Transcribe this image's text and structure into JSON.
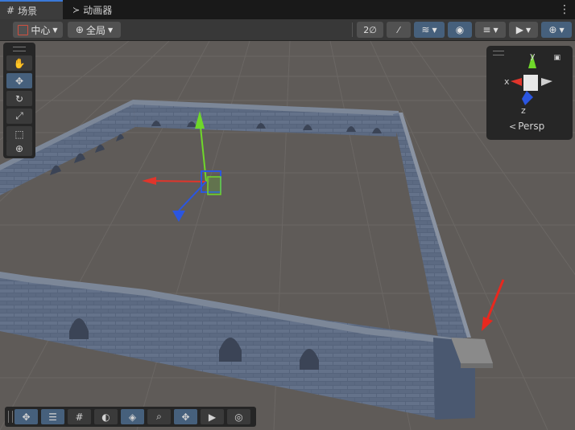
{
  "tabs": [
    {
      "label": "场景",
      "icon": "grid-icon",
      "active": true
    },
    {
      "label": "动画器",
      "icon": "animator-icon",
      "active": false
    }
  ],
  "toolbar": {
    "pivot_label": "中心",
    "space_label": "全局"
  },
  "scene_gizmo": {
    "projection_label": "Persp",
    "axis_y": "y",
    "axis_x": "x",
    "axis_z": "z"
  },
  "tools": [
    "hand-tool",
    "move-tool",
    "rotate-tool",
    "scale-tool",
    "rect-tool",
    "transform-tool"
  ],
  "selected_tool": "move-tool",
  "colors": {
    "accent": "#3a79d8",
    "selected_button": "#46607c",
    "axis_x": "#e0352b",
    "axis_y": "#6fd82a",
    "axis_z": "#2b56e0",
    "wall": "#5a6880",
    "floor": "#5e5955",
    "arrow_annotation": "#e8281e"
  }
}
